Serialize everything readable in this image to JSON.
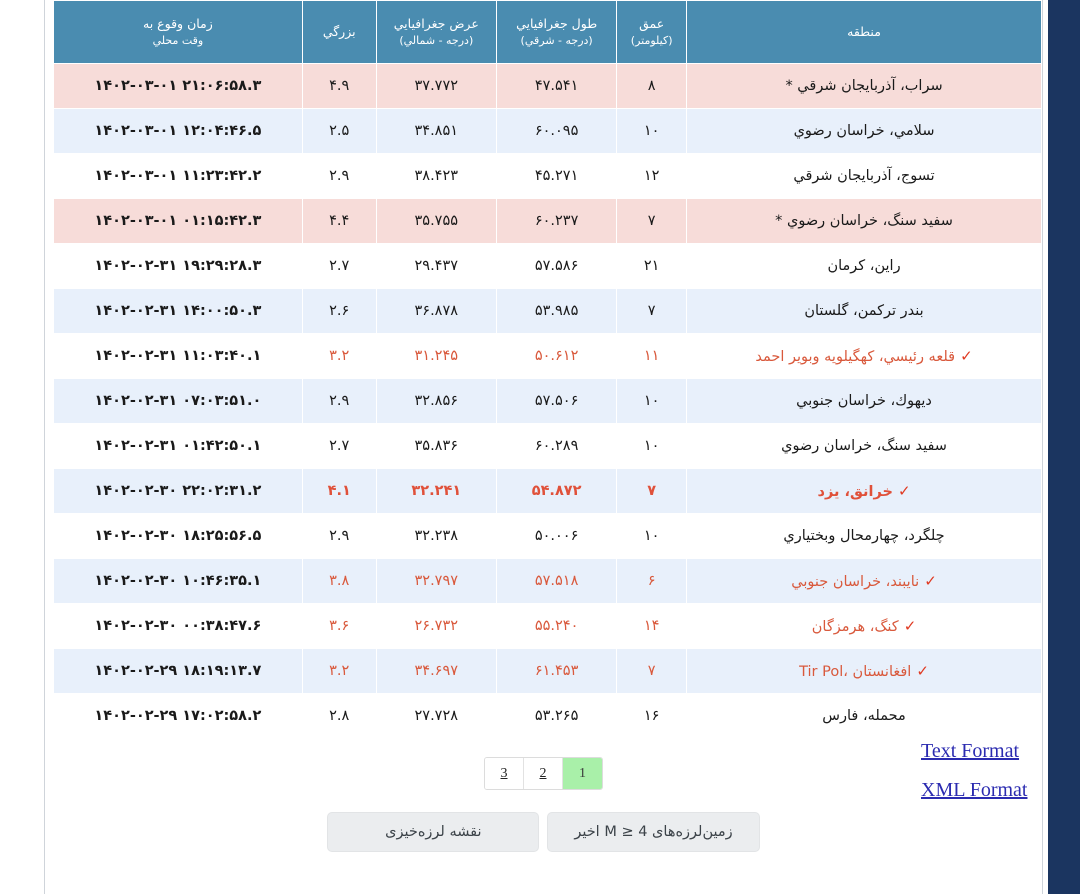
{
  "colors": {
    "header_bg": "#4a8cb0",
    "row_blue": "#e8f0fb",
    "row_pink": "#f7dcd9",
    "highlight_text": "#d9593c",
    "time_text": "#1c1ca0",
    "pager_active_bg": "#a9f0a9",
    "right_rail": "#1b3560"
  },
  "table": {
    "columns": [
      {
        "key": "region",
        "title": "منطقه",
        "sub": ""
      },
      {
        "key": "depth",
        "title": "عمق",
        "sub": "(کیلومتر)"
      },
      {
        "key": "lon",
        "title": "طول جغرافيايي",
        "sub": "(درجه - شرقي)"
      },
      {
        "key": "lat",
        "title": "عرض جغرافيايي",
        "sub": "(درجه - شمالي)"
      },
      {
        "key": "mag",
        "title": "بزرگي",
        "sub": ""
      },
      {
        "key": "time",
        "title": "زمان وقوع به",
        "sub": "وقت محلي"
      }
    ],
    "rows": [
      {
        "region": "سراب، آذربايجان شرقي *",
        "depth": "۸",
        "lon": "۴۷.۵۴۱",
        "lat": "۳۷.۷۷۲",
        "mag": "۴.۹",
        "time": "۱۴۰۲-۰۳-۰۱ ۲۱:۰۶:۵۸.۳",
        "tint": "pink",
        "emphasis": "none",
        "check": false,
        "latin": false
      },
      {
        "region": "سلامي، خراسان رضوي",
        "depth": "۱۰",
        "lon": "۶۰.۰۹۵",
        "lat": "۳۴.۸۵۱",
        "mag": "۲.۵",
        "time": "۱۴۰۲-۰۳-۰۱ ۱۲:۰۴:۴۶.۵",
        "tint": "blue",
        "emphasis": "none",
        "check": false,
        "latin": false
      },
      {
        "region": "تسوج، آذربايجان شرقي",
        "depth": "۱۲",
        "lon": "۴۵.۲۷۱",
        "lat": "۳۸.۴۲۳",
        "mag": "۲.۹",
        "time": "۱۴۰۲-۰۳-۰۱ ۱۱:۲۳:۴۲.۲",
        "tint": "white",
        "emphasis": "none",
        "check": false,
        "latin": false
      },
      {
        "region": "سفيد سنگ، خراسان رضوي *",
        "depth": "۷",
        "lon": "۶۰.۲۳۷",
        "lat": "۳۵.۷۵۵",
        "mag": "۴.۴",
        "time": "۱۴۰۲-۰۳-۰۱ ۰۱:۱۵:۴۲.۳",
        "tint": "pink",
        "emphasis": "none",
        "check": false,
        "latin": false
      },
      {
        "region": "راين، کرمان",
        "depth": "۲۱",
        "lon": "۵۷.۵۸۶",
        "lat": "۲۹.۴۳۷",
        "mag": "۲.۷",
        "time": "۱۴۰۲-۰۲-۳۱ ۱۹:۲۹:۲۸.۳",
        "tint": "white",
        "emphasis": "none",
        "check": false,
        "latin": false
      },
      {
        "region": "بندر ترکمن، گلستان",
        "depth": "۷",
        "lon": "۵۳.۹۸۵",
        "lat": "۳۶.۸۷۸",
        "mag": "۲.۶",
        "time": "۱۴۰۲-۰۲-۳۱ ۱۴:۰۰:۵۰.۳",
        "tint": "blue",
        "emphasis": "none",
        "check": false,
        "latin": false
      },
      {
        "region": "قلعه رئيسي، کهگيلويه وبوير احمد",
        "depth": "۱۱",
        "lon": "۵۰.۶۱۲",
        "lat": "۳۱.۲۴۵",
        "mag": "۳.۲",
        "time": "۱۴۰۲-۰۲-۳۱ ۱۱:۰۳:۴۰.۱",
        "tint": "white",
        "emphasis": "hot",
        "check": true,
        "latin": false
      },
      {
        "region": "ديهوك، خراسان جنوبي",
        "depth": "۱۰",
        "lon": "۵۷.۵۰۶",
        "lat": "۳۲.۸۵۶",
        "mag": "۲.۹",
        "time": "۱۴۰۲-۰۲-۳۱ ۰۷:۰۳:۵۱.۰",
        "tint": "blue",
        "emphasis": "none",
        "check": false,
        "latin": false
      },
      {
        "region": "سفيد سنگ، خراسان رضوي",
        "depth": "۱۰",
        "lon": "۶۰.۲۸۹",
        "lat": "۳۵.۸۳۶",
        "mag": "۲.۷",
        "time": "۱۴۰۲-۰۲-۳۱ ۰۱:۴۲:۵۰.۱",
        "tint": "white",
        "emphasis": "none",
        "check": false,
        "latin": false
      },
      {
        "region": "خرانق، يزد",
        "depth": "۷",
        "lon": "۵۴.۸۷۲",
        "lat": "۳۲.۲۴۱",
        "mag": "۴.۱",
        "time": "۱۴۰۲-۰۲-۳۰ ۲۲:۰۲:۳۱.۲",
        "tint": "blue",
        "emphasis": "strong",
        "check": true,
        "latin": false
      },
      {
        "region": "چلگرد، چهارمحال وبختياري",
        "depth": "۱۰",
        "lon": "۵۰.۰۰۶",
        "lat": "۳۲.۲۳۸",
        "mag": "۲.۹",
        "time": "۱۴۰۲-۰۲-۳۰ ۱۸:۲۵:۵۶.۵",
        "tint": "white",
        "emphasis": "none",
        "check": false,
        "latin": false
      },
      {
        "region": "نايبند، خراسان جنوبي",
        "depth": "۶",
        "lon": "۵۷.۵۱۸",
        "lat": "۳۲.۷۹۷",
        "mag": "۳.۸",
        "time": "۱۴۰۲-۰۲-۳۰ ۱۰:۴۶:۳۵.۱",
        "tint": "blue",
        "emphasis": "hot",
        "check": true,
        "latin": false
      },
      {
        "region": "کنگ، هرمزگان",
        "depth": "۱۴",
        "lon": "۵۵.۲۴۰",
        "lat": "۲۶.۷۳۲",
        "mag": "۳.۶",
        "time": "۱۴۰۲-۰۲-۳۰ ۰۰:۳۸:۴۷.۶",
        "tint": "white",
        "emphasis": "hot",
        "check": true,
        "latin": false
      },
      {
        "region": "Tir Pol، افغانستان",
        "depth": "۷",
        "lon": "۶۱.۴۵۳",
        "lat": "۳۴.۶۹۷",
        "mag": "۳.۲",
        "time": "۱۴۰۲-۰۲-۲۹ ۱۸:۱۹:۱۳.۷",
        "tint": "blue",
        "emphasis": "hot",
        "check": true,
        "latin": true
      },
      {
        "region": "محمله، فارس",
        "depth": "۱۶",
        "lon": "۵۳.۲۶۵",
        "lat": "۲۷.۷۲۸",
        "mag": "۲.۸",
        "time": "۱۴۰۲-۰۲-۲۹ ۱۷:۰۲:۵۸.۲",
        "tint": "white",
        "emphasis": "none",
        "check": false,
        "latin": false
      }
    ]
  },
  "pagination": {
    "pages": [
      {
        "label": "3",
        "active": false
      },
      {
        "label": "2",
        "active": false
      },
      {
        "label": "1",
        "active": true
      }
    ]
  },
  "formats": {
    "text_label": "Text Format",
    "xml_label": "XML Format"
  },
  "buttons": {
    "recent_m4": "زمین‌لرزه‌های M ≥ 4 اخیر",
    "seismicity_map": "نقشه لرزه‌خیزی"
  }
}
